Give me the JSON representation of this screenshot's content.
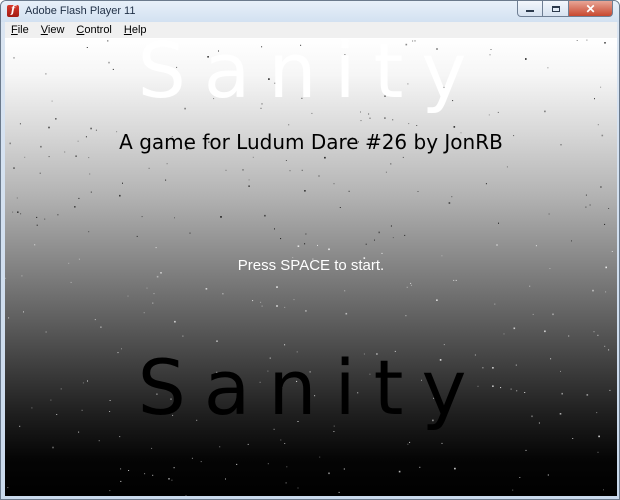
{
  "window": {
    "title": "Adobe Flash Player 11",
    "app_icon_glyph": "f",
    "controls": {
      "minimize_icon": "minimize-icon",
      "maximize_icon": "maximize-icon",
      "close_glyph": "✕"
    }
  },
  "menubar": {
    "items": [
      {
        "key": "F",
        "rest": "ile"
      },
      {
        "key": "V",
        "rest": "iew"
      },
      {
        "key": "C",
        "rest": "ontrol"
      },
      {
        "key": "H",
        "rest": "elp"
      }
    ]
  },
  "game": {
    "title": "Sanity",
    "subtitle": "A game for Ludum Dare #26 by JonRB",
    "prompt": "Press SPACE to start.",
    "reflection_title": "Sanity"
  },
  "colors": {
    "stage_top": "#ffffff",
    "stage_bottom": "#000000",
    "title_top_color": "#ffffff",
    "title_bottom_color": "#000000",
    "particle_light": "#ffffff",
    "particle_dark": "#000000"
  }
}
